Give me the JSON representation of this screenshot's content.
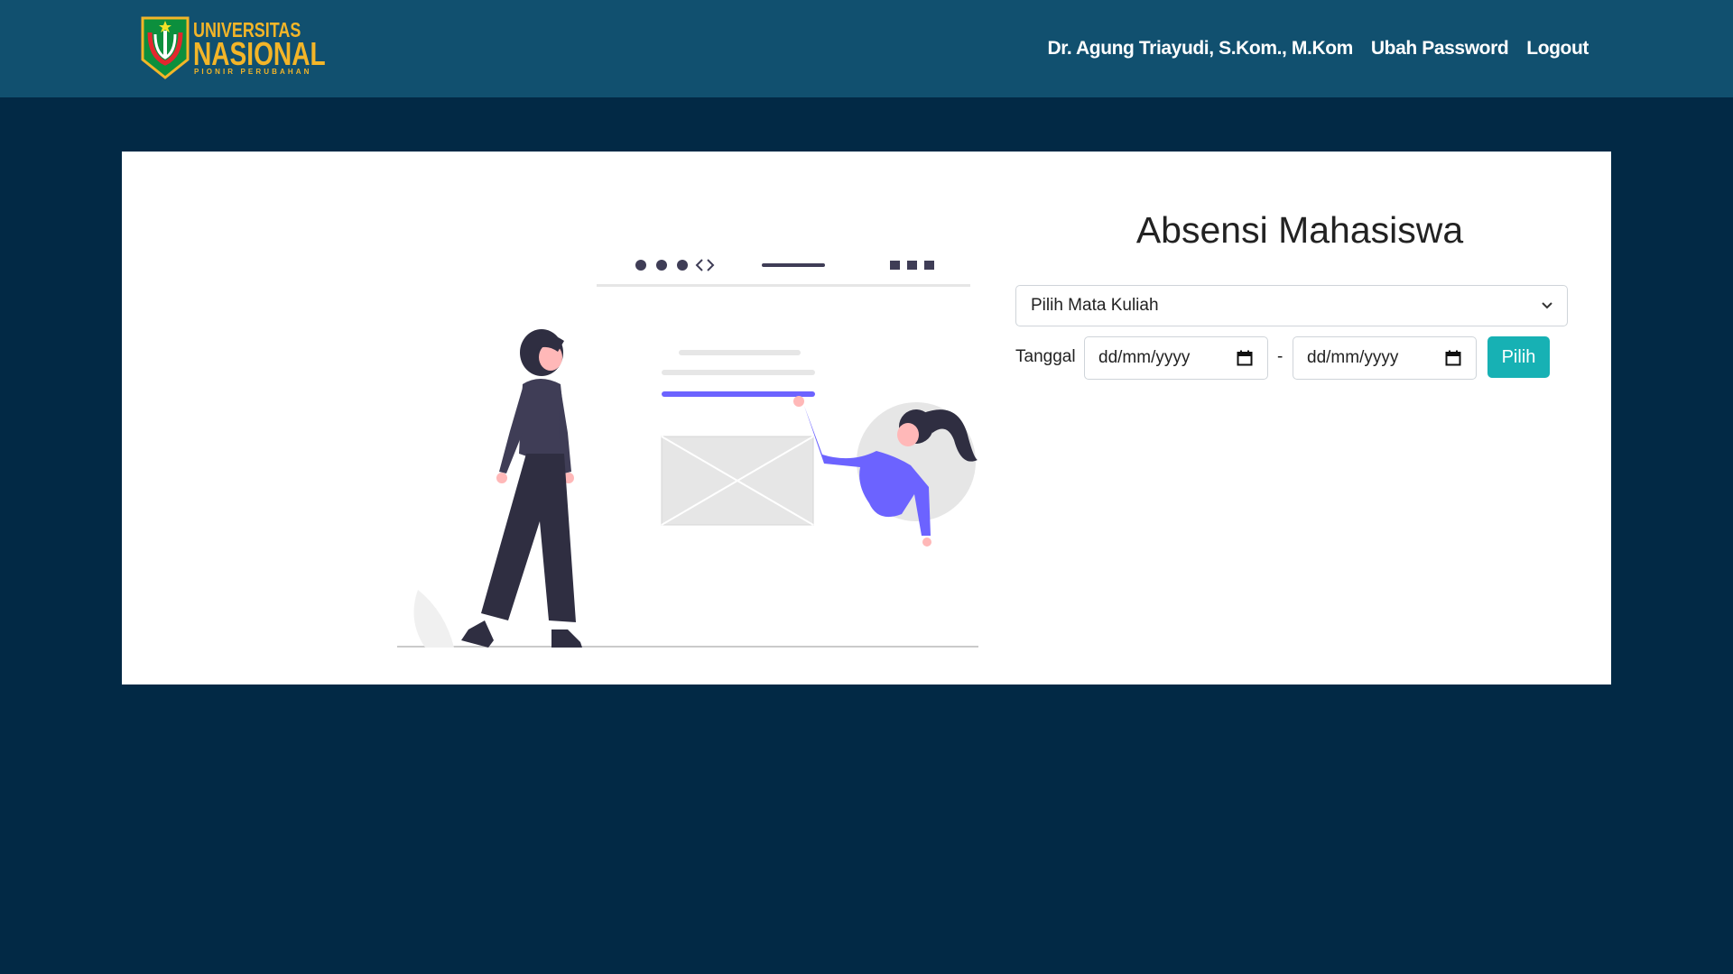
{
  "brand": {
    "line1": "UNIVERSITAS",
    "line2": "NASIONAL",
    "tagline": "PIONIR PERUBAHAN"
  },
  "nav": {
    "user_name": "Dr. Agung Triayudi, S.Kom., M.Kom",
    "change_password": "Ubah Password",
    "logout": "Logout"
  },
  "page": {
    "title": "Absensi Mahasiswa"
  },
  "form": {
    "course_select": "Pilih Mata Kuliah",
    "date_label": "Tanggal",
    "start_date": "dd/mm/yyyy",
    "separator": "-",
    "end_date": "dd/mm/yyyy",
    "submit": "Pilih"
  },
  "colors": {
    "navbar": "#11506f",
    "background": "#022945",
    "accent_button": "#17b1b4",
    "brand_gold": "#f3b528",
    "illustration_purple": "#6c63ff"
  },
  "icons": {
    "select_arrow": "chevron-down-icon",
    "date_picker": "calendar-icon"
  }
}
